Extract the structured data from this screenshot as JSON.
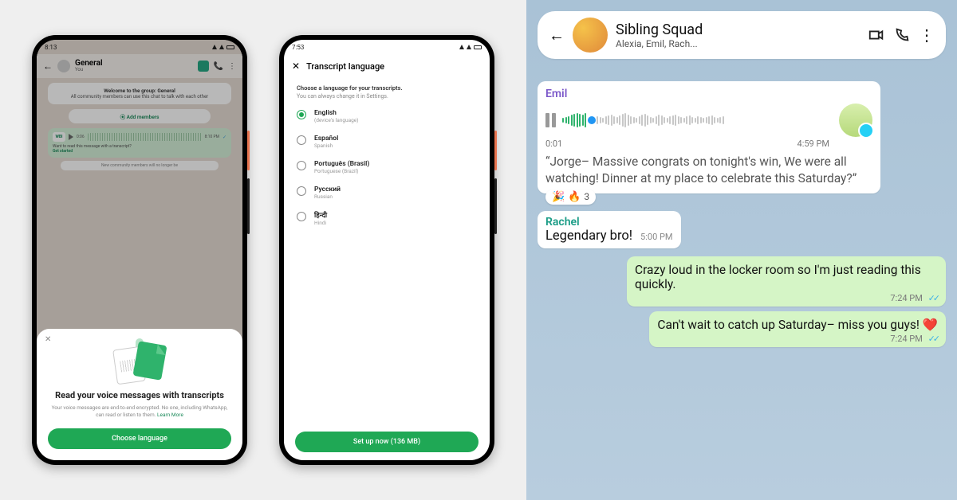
{
  "phone1": {
    "status_time": "8:13",
    "appbar": {
      "title": "General",
      "subtitle": "You"
    },
    "welcome_title": "Welcome to the group: General",
    "welcome_body": "All community members can use this chat to talk with each other",
    "add_members": "Add members",
    "voice": {
      "badge": "WBI",
      "dur": "0:06",
      "time": "8:10 PM"
    },
    "tip_text": "Want to read this message with a transcript?",
    "tip_link": "Get started",
    "sys_msg": "New community members will no longer be",
    "sheet": {
      "title": "Read your voice messages with transcripts",
      "body": "Your voice messages are end-to-end encrypted. No one, including WhatsApp, can read or listen to them.",
      "learn_more": "Learn More",
      "cta": "Choose language"
    }
  },
  "phone2": {
    "status_time": "7:53",
    "title": "Transcript language",
    "hint1": "Choose a language for your transcripts.",
    "hint2": "You can always change it in Settings.",
    "langs": [
      {
        "name": "English",
        "sub": "(device's language)",
        "selected": true
      },
      {
        "name": "Español",
        "sub": "Spanish",
        "selected": false
      },
      {
        "name": "Português (Brasil)",
        "sub": "Portuguese (Brazil)",
        "selected": false
      },
      {
        "name": "Русский",
        "sub": "Russian",
        "selected": false
      },
      {
        "name": "हिन्दी",
        "sub": "Hindi",
        "selected": false
      }
    ],
    "cta": "Set up now (136 MB)"
  },
  "chat": {
    "group_name": "Sibling Squad",
    "members": "Alexia, Emil, Rach...",
    "emil": {
      "sender": "Emil",
      "pos": "0:01",
      "time": "4:59 PM",
      "transcript": "“Jorge– Massive congrats on tonight's win, We were all watching! Dinner at my place to celebrate this Saturday?”",
      "reaction_count": "3"
    },
    "rachel": {
      "sender": "Rachel",
      "text": "Legendary bro!",
      "time": "5:00 PM"
    },
    "out1": {
      "text": "Crazy loud in the locker room so I'm just reading this quickly.",
      "time": "7:24 PM"
    },
    "out2": {
      "text": "Can't wait to catch up Saturday– miss you guys! ❤️",
      "time": "7:24 PM"
    }
  }
}
